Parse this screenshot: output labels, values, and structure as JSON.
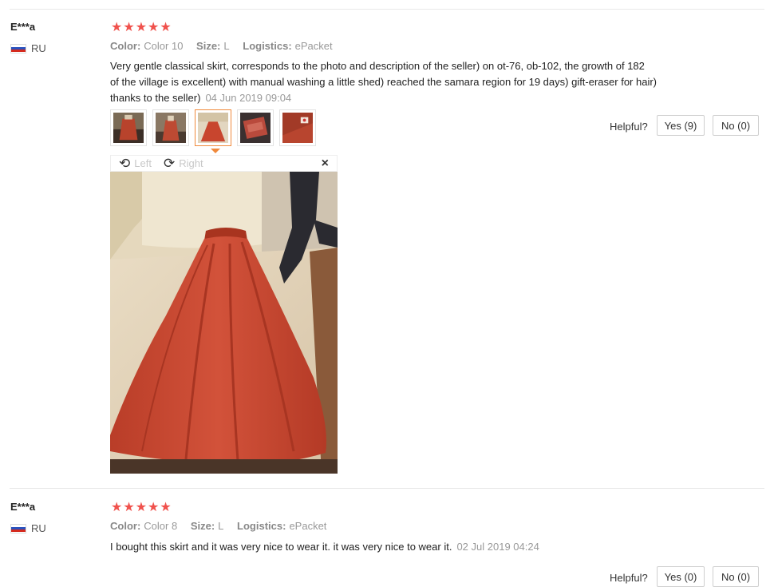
{
  "reviews": [
    {
      "user": "E***a",
      "country": "RU",
      "stars": "★★★★★",
      "color_label": "Color:",
      "color_value": "Color 10",
      "size_label": "Size:",
      "size_value": "L",
      "logistics_label": "Logistics:",
      "logistics_value": "ePacket",
      "text_line1": "Very gentle classical skirt, corresponds to the photo and description of the seller) on ot-76, ob-102, the growth of 182",
      "text_line2": "of the village is excellent) with manual washing a little shed) reached the samara region for 19 days) gift-eraser for hair)",
      "text_line3": "thanks to the seller)",
      "date": "04 Jun 2019 09:04",
      "helpful_label": "Helpful?",
      "yes_label": "Yes (9)",
      "no_label": "No (0)",
      "viewer": {
        "left_label": "Left",
        "right_label": "Right",
        "close": "×"
      }
    },
    {
      "user": "E***a",
      "country": "RU",
      "stars": "★★★★★",
      "color_label": "Color:",
      "color_value": "Color 8",
      "size_label": "Size:",
      "size_value": "L",
      "logistics_label": "Logistics:",
      "logistics_value": "ePacket",
      "text_line1": "I bought this skirt and it was very nice to wear it. it was very nice to wear it.",
      "date": "02 Jul 2019 04:24",
      "helpful_label": "Helpful?",
      "yes_label": "Yes (0)",
      "no_label": "No (0)"
    }
  ],
  "colors": {
    "star": "#f0514c",
    "active_thumb": "#f08a3c",
    "skirt": "#c8452e"
  },
  "icons": {
    "rotate_left": "rotate-left-icon",
    "rotate_right": "rotate-right-icon",
    "close": "close-icon",
    "flag": "russia-flag-icon"
  }
}
